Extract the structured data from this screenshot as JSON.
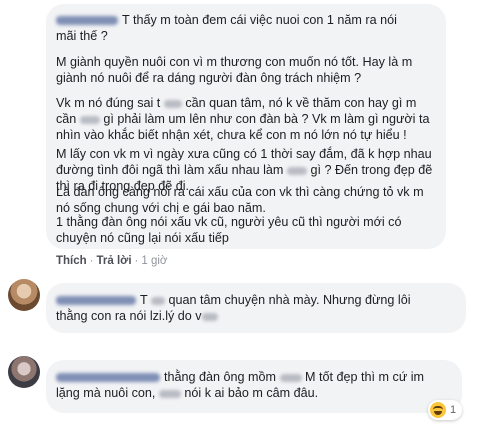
{
  "comments": [
    {
      "paragraphs": [
        [
          "T thấy m toàn đem cái việc nuoi con 1 năm ra nói",
          "mãi thế ?"
        ],
        [
          "M giành quyền nuôi con vì m thương con muốn nó tốt. Hay là m",
          "giành nó nuôi để ra dáng người đàn ông trách nhiệm ?"
        ],
        [
          "Vk m nó đúng sai t",
          "cần quan tâm, nó k về thăm con hay gì m",
          "cần",
          "gì phải làm um lên như con đàn bà ? Vk m làm gì người ta",
          "nhìn vào khắc biết nhận xét, chưa kể con m nó lớn nó tự hiểu !"
        ],
        [
          "M lấy con vk m vì ngày xưa cũng có 1 thời say đắm, đã k hợp nhau",
          "đường tình đôi ngã thì làm xấu nhau làm",
          "gì ? Đến trong đẹp đẽ",
          "thì ra đi trong đẹp đẽ đi."
        ],
        [
          "Là đàn ông càng nói ra cái xấu của con vk thì càng chứng tỏ vk m",
          "nó sống chung với chị e gái bao năm."
        ],
        [
          "1 thằng đàn ông nói xấu vk cũ, người yêu cũ thì người mới có",
          "chuyện nó cũng lại nói xấu tiếp"
        ]
      ],
      "actions": {
        "like": "Thích",
        "reply": "Trả lời",
        "time": "1 giờ",
        "separator": "·"
      }
    },
    {
      "lines": [
        "T",
        "quan tâm chuyện nhà mày. Nhưng đừng lôi",
        "thằng con ra nói lzi.lý do v"
      ]
    },
    {
      "lines": [
        "thằng đàn ông mồm",
        "M tốt đẹp thì m cứ im",
        "lặng mà nuôi con,",
        "nói k ai bảo m câm đâu."
      ],
      "reaction": {
        "icon": "haha-emoji-icon",
        "count": "1"
      }
    }
  ]
}
